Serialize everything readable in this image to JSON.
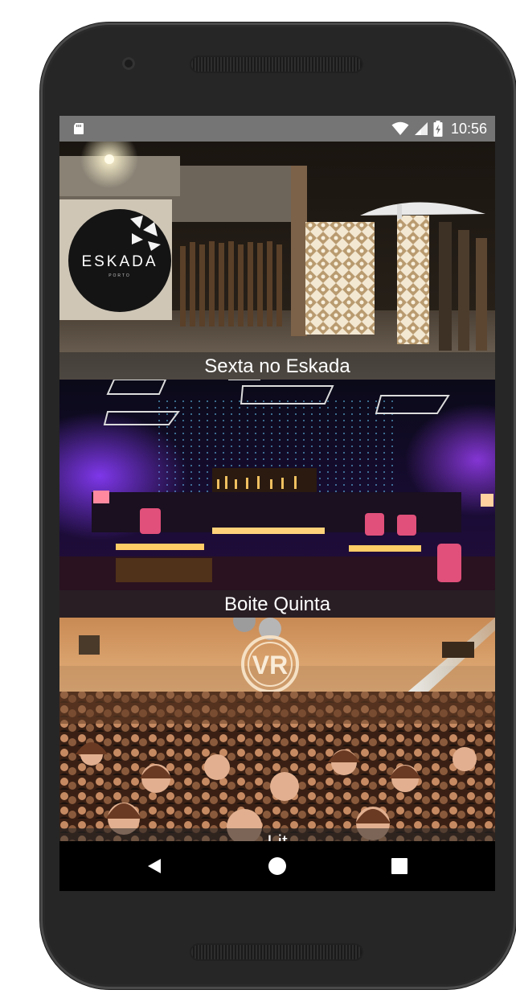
{
  "status_bar": {
    "time": "10:56",
    "icons": [
      "sd-card-icon",
      "wifi-icon",
      "signal-icon",
      "battery-charging-icon"
    ]
  },
  "venues": [
    {
      "title": "Sexta no Eskada",
      "image": "club-entrance-photo",
      "logo_text": "ESKADA",
      "logo_sub": "PORTO"
    },
    {
      "title": "Boite Quinta",
      "image": "nightclub-interior-photo"
    },
    {
      "title": "Lit",
      "image": "crowd-party-photo",
      "sign_text": "VR"
    }
  ],
  "nav_bar": {
    "icons": [
      "back-icon",
      "home-icon",
      "recents-icon"
    ]
  },
  "colors": {
    "status_bar": "#757575",
    "nav_bar": "#000000",
    "title_text": "#ffffff",
    "device_body": "#2a2a2a"
  }
}
